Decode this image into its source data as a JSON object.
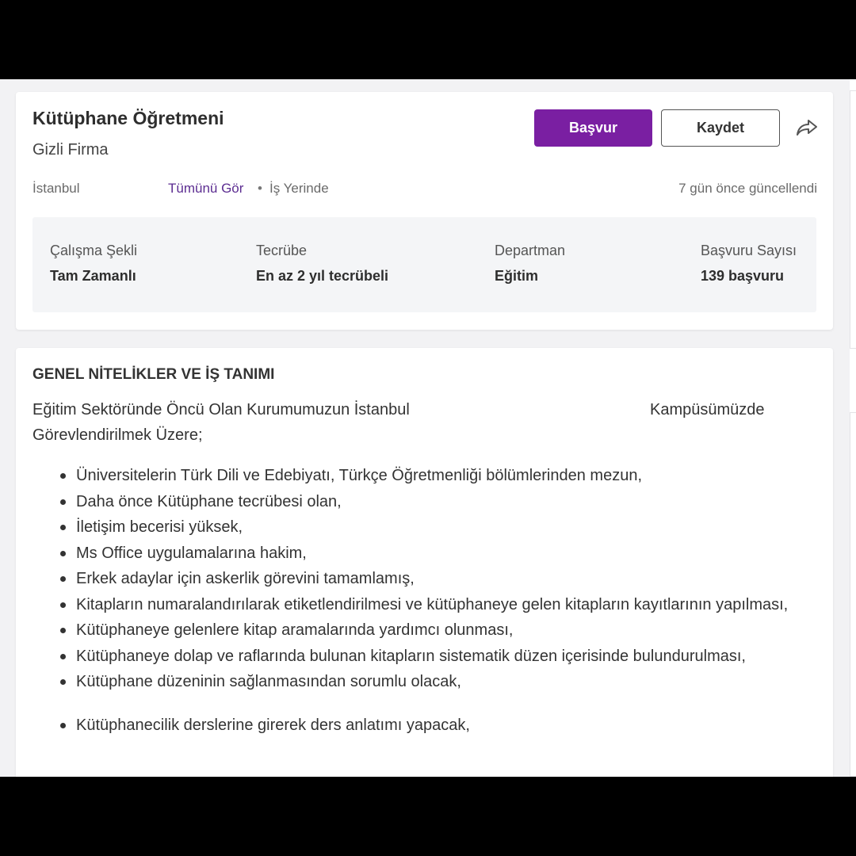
{
  "job": {
    "title": "Kütüphane Öğretmeni",
    "company": "Gizli Firma",
    "city": "İstanbul",
    "see_all": "Tümünü Gör",
    "separator": "•",
    "work_type": "İş Yerinde",
    "updated": "7 gün önce güncellendi"
  },
  "actions": {
    "apply_label": "Başvur",
    "save_label": "Kaydet",
    "share_icon": "share-arrow-icon"
  },
  "details": [
    {
      "label": "Çalışma Şekli",
      "value": "Tam Zamanlı"
    },
    {
      "label": "Tecrübe",
      "value": "En az 2 yıl tecrübeli"
    },
    {
      "label": "Departman",
      "value": "Eğitim"
    },
    {
      "label": "Başvuru Sayısı",
      "value": "139 başvuru"
    }
  ],
  "description": {
    "heading": "GENEL NİTELİKLER VE İŞ TANIMI",
    "intro_part1": "Eğitim Sektöründe Öncü Olan Kurumumuzun İstanbul",
    "intro_part2": "Kampüsümüzde",
    "intro_part3": "Görevlendirilmek Üzere;",
    "items": [
      "Üniversitelerin Türk Dili ve Edebiyatı, Türkçe Öğretmenliği bölümlerinden mezun,",
      "Daha önce Kütüphane tecrübesi olan,",
      "İletişim becerisi yüksek,",
      "Ms Office uygulamalarına hakim,",
      "Erkek adaylar için askerlik görevini tamamlamış,",
      "Kitapların numaralandırılarak etiketlendirilmesi ve kütüphaneye gelen kitapların kayıtlarının yapılması,",
      "Kütüphaneye gelenlere kitap aramalarında yardımcı olunması,",
      "Kütüphaneye dolap ve raflarında bulunan kitapların sistematik düzen içerisinde bulundurulması,",
      "Kütüphane düzeninin sağlanmasından sorumlu olacak,",
      "Kütüphanecilik derslerine girerek ders anlatımı yapacak,"
    ]
  },
  "colors": {
    "accent": "#7a1fa2",
    "link": "#5c2d91",
    "background": "#f2f2f4",
    "info_box": "#f4f5f7"
  }
}
